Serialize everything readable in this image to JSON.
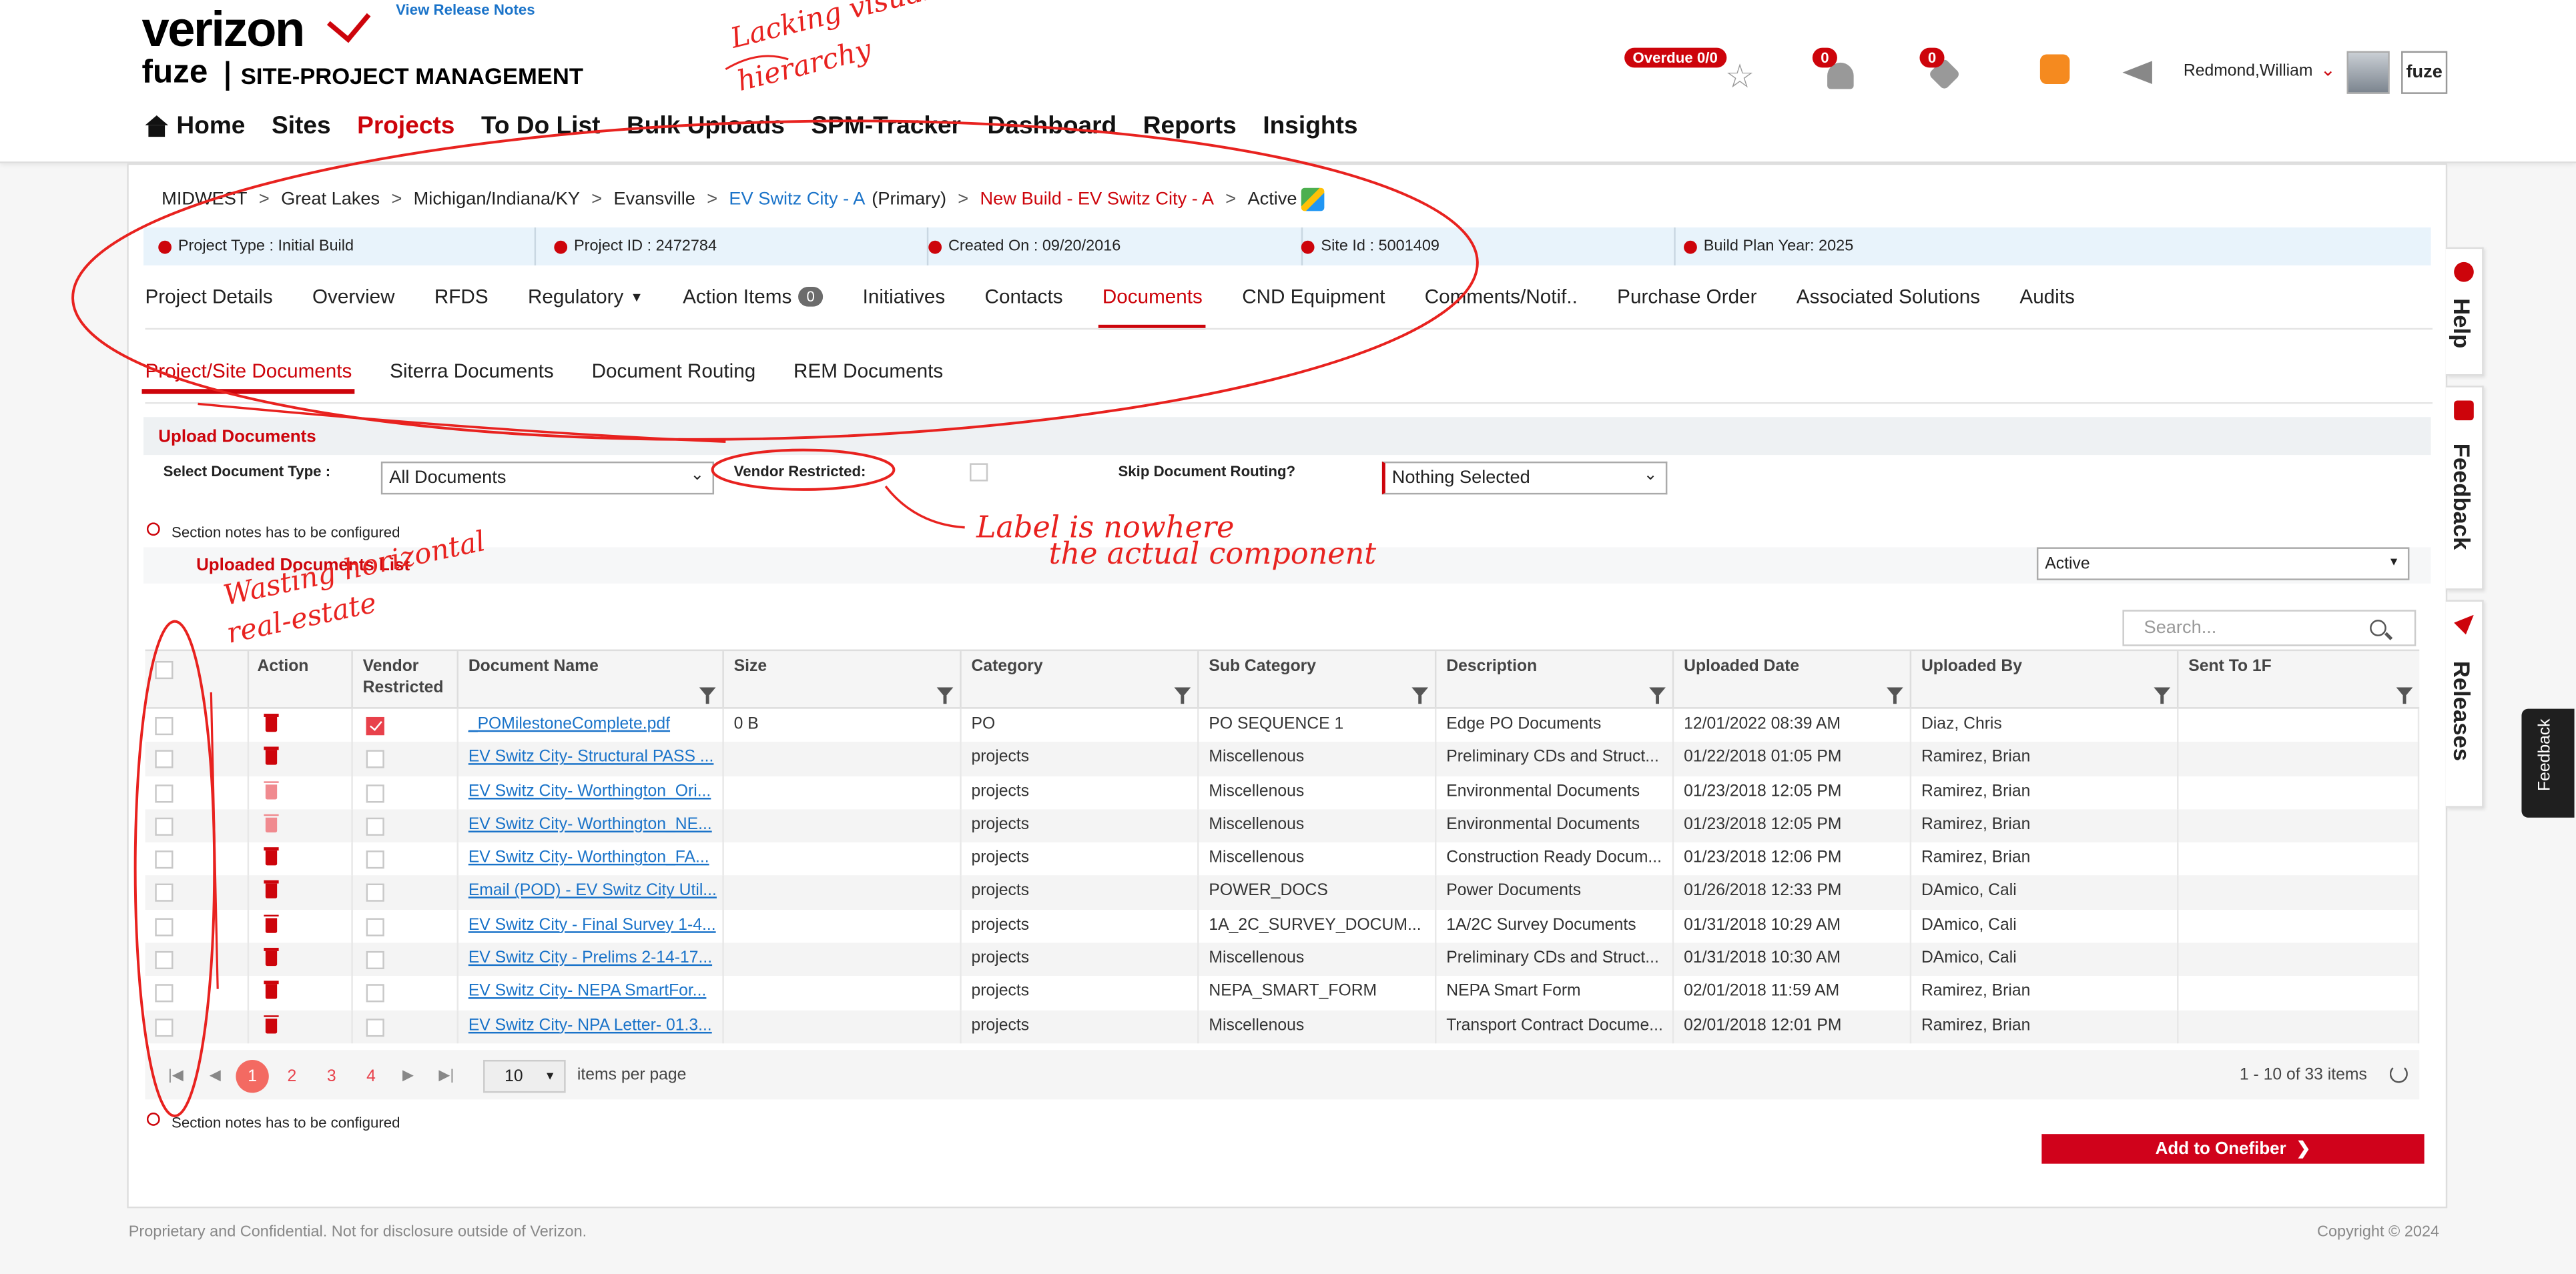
{
  "header": {
    "logo_main": "verizon",
    "logo_sub": "fuze",
    "logo_product": "SITE-PROJECT MANAGEMENT",
    "release_notes": "View Release Notes",
    "overdue_badge": "Overdue 0/0",
    "bell_count": "0",
    "tag_count": "0",
    "user_name": "Redmond,William",
    "fuze_box": "fuze"
  },
  "nav": [
    {
      "label": "Home"
    },
    {
      "label": "Sites"
    },
    {
      "label": "Projects"
    },
    {
      "label": "To Do List"
    },
    {
      "label": "Bulk Uploads"
    },
    {
      "label": "SPM-Tracker"
    },
    {
      "label": "Dashboard"
    },
    {
      "label": "Reports"
    },
    {
      "label": "Insights"
    }
  ],
  "breadcrumb": [
    "MIDWEST",
    "Great Lakes",
    "Michigan/Indiana/KY",
    "Evansville",
    "EV Switz City - A",
    "(Primary)",
    "New Build - EV Switz City - A",
    "Active"
  ],
  "info": [
    "Project Type : Initial Build",
    "Project ID : 2472784",
    "Created On : 09/20/2016",
    "Site Id : 5001409",
    "Build Plan Year: 2025"
  ],
  "tabs": [
    "Project Details",
    "Overview",
    "RFDS",
    "Regulatory",
    "Action Items",
    "Initiatives",
    "Contacts",
    "Documents",
    "CND Equipment",
    "Comments/Notif..",
    "Purchase Order",
    "Associated Solutions",
    "Audits"
  ],
  "action_items_count": "0",
  "subtabs": [
    "Project/Site Documents",
    "Siterra Documents",
    "Document Routing",
    "REM Documents"
  ],
  "upload": {
    "title": "Upload Documents",
    "doc_type_label": "Select Document Type :",
    "doc_type_value": "All Documents",
    "vendor_label": "Vendor Restricted:",
    "skip_label": "Skip Document Routing?",
    "skip_value": "Nothing Selected",
    "note": "Section notes has to be configured"
  },
  "list": {
    "title": "Uploaded Documents List",
    "status_value": "Active",
    "search_placeholder": "Search...",
    "columns": [
      "Action",
      "Vendor Restricted",
      "Document Name",
      "Size",
      "Category",
      "Sub Category",
      "Description",
      "Uploaded Date",
      "Uploaded By",
      "Sent To 1F"
    ],
    "rows": [
      {
        "trash": "dark",
        "vendor": true,
        "name": "_POMilestoneComplete.pdf",
        "size": "0 B",
        "category": "PO",
        "sub": "PO SEQUENCE 1",
        "desc": "Edge PO Documents",
        "date": "12/01/2022 08:39 AM",
        "by": "Diaz, Chris"
      },
      {
        "trash": "dark",
        "vendor": false,
        "name": "EV Switz City- Structural PASS ...",
        "size": "",
        "category": "projects",
        "sub": "Miscellenous",
        "desc": "Preliminary CDs and Struct...",
        "date": "01/22/2018 01:05 PM",
        "by": "Ramirez, Brian"
      },
      {
        "trash": "light",
        "vendor": false,
        "name": "EV Switz City- Worthington_Ori...",
        "size": "",
        "category": "projects",
        "sub": "Miscellenous",
        "desc": "Environmental Documents",
        "date": "01/23/2018 12:05 PM",
        "by": "Ramirez, Brian"
      },
      {
        "trash": "light",
        "vendor": false,
        "name": "EV Switz City- Worthington_NE...",
        "size": "",
        "category": "projects",
        "sub": "Miscellenous",
        "desc": "Environmental Documents",
        "date": "01/23/2018 12:05 PM",
        "by": "Ramirez, Brian"
      },
      {
        "trash": "dark",
        "vendor": false,
        "name": "EV Switz City- Worthington_FA...",
        "size": "",
        "category": "projects",
        "sub": "Miscellenous",
        "desc": "Construction Ready Docum...",
        "date": "01/23/2018 12:06 PM",
        "by": "Ramirez, Brian"
      },
      {
        "trash": "dark",
        "vendor": false,
        "name": "Email (POD) - EV Switz City Util...",
        "size": "",
        "category": "projects",
        "sub": "POWER_DOCS",
        "desc": "Power Documents",
        "date": "01/26/2018 12:33 PM",
        "by": "DAmico, Cali"
      },
      {
        "trash": "dark",
        "vendor": false,
        "name": "EV Switz City - Final Survey 1-4...",
        "size": "",
        "category": "projects",
        "sub": "1A_2C_SURVEY_DOCUM...",
        "desc": "1A/2C Survey Documents",
        "date": "01/31/2018 10:29 AM",
        "by": "DAmico, Cali"
      },
      {
        "trash": "dark",
        "vendor": false,
        "name": "EV Switz City - Prelims 2-14-17...",
        "size": "",
        "category": "projects",
        "sub": "Miscellenous",
        "desc": "Preliminary CDs and Struct...",
        "date": "01/31/2018 10:30 AM",
        "by": "DAmico, Cali"
      },
      {
        "trash": "dark",
        "vendor": false,
        "name": "EV Switz City- NEPA SmartFor...",
        "size": "",
        "category": "projects",
        "sub": "NEPA_SMART_FORM",
        "desc": "NEPA Smart Form",
        "date": "02/01/2018 11:59 AM",
        "by": "Ramirez, Brian"
      },
      {
        "trash": "dark",
        "vendor": false,
        "name": "EV Switz City- NPA Letter- 01.3...",
        "size": "",
        "category": "projects",
        "sub": "Miscellenous",
        "desc": "Transport Contract Docume...",
        "date": "02/01/2018 12:01 PM",
        "by": "Ramirez, Brian"
      }
    ]
  },
  "pager": {
    "pages": [
      "1",
      "2",
      "3",
      "4"
    ],
    "page_size": "10",
    "per_page_label": "items per page",
    "summary": "1 - 10 of 33 items"
  },
  "add_button": "Add to Onefiber",
  "footer_left": "Proprietary and Confidential. Not for disclosure outside of Verizon.",
  "footer_right": "Copyright © 2024",
  "side_tabs": [
    "Help",
    "Feedback",
    "Releases"
  ],
  "feedback_dark": "Feedback",
  "annotations": {
    "hierarchy_1": "Lacking visual",
    "hierarchy_2": "hierarchy",
    "label_1": "Label is nowhere",
    "label_2": "the actual component",
    "wasting_1": "Wasting horizontal",
    "wasting_2": "real-estate"
  },
  "colors": {
    "brand_red": "#cd040b",
    "link_blue": "#1a73c9",
    "annotation_red": "#e8221f"
  }
}
